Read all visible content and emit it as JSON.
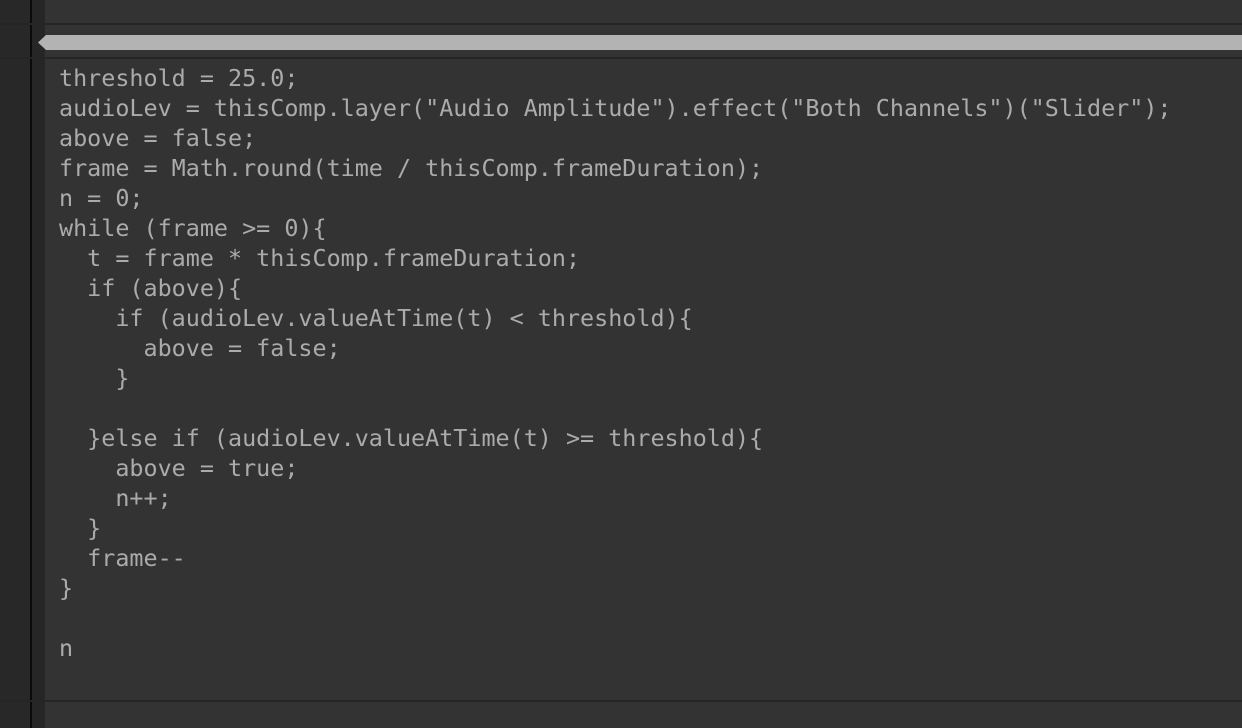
{
  "editor": {
    "code_lines": [
      "threshold = 25.0;",
      "audioLev = thisComp.layer(\"Audio Amplitude\").effect(\"Both Channels\")(\"Slider\");",
      "above = false;",
      "frame = Math.round(time / thisComp.frameDuration);",
      "n = 0;",
      "while (frame >= 0){",
      "  t = frame * thisComp.frameDuration;",
      "  if (above){",
      "    if (audioLev.valueAtTime(t) < threshold){",
      "      above = false;",
      "    }",
      "",
      "  }else if (audioLev.valueAtTime(t) >= threshold){",
      "    above = true;",
      "    n++;",
      "  }",
      "  frame--",
      "}",
      "",
      "n"
    ]
  },
  "colors": {
    "background": "#333333",
    "text": "#ababab",
    "scrollbar": "#b3b3b3"
  }
}
